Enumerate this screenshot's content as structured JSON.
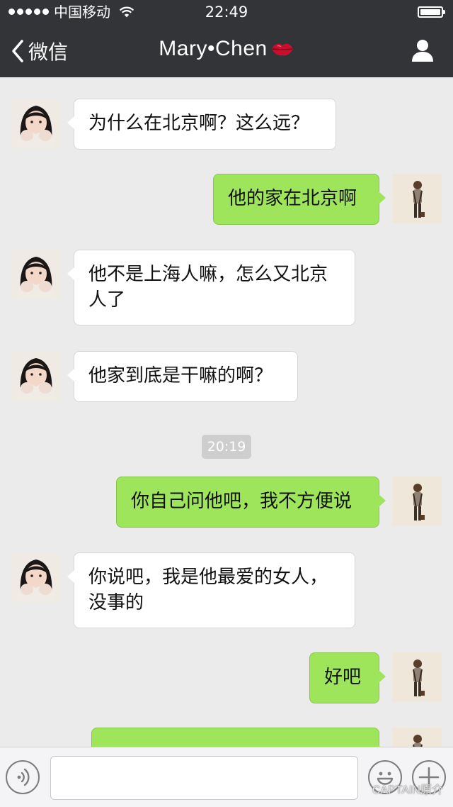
{
  "status_bar": {
    "carrier": "中国移动",
    "time": "22:49",
    "battery_level": 1.0
  },
  "nav": {
    "back_label": "微信",
    "title": "Mary•Chen",
    "title_emoji": "lips-icon",
    "right_icon": "person-icon"
  },
  "messages": [
    {
      "side": "in",
      "text": "为什么在北京啊？这么远？"
    },
    {
      "side": "out",
      "text": "他的家在北京啊"
    },
    {
      "side": "in",
      "lines": [
        "他不是上海人嘛，怎么又北京",
        "人了"
      ]
    },
    {
      "side": "in",
      "text": "他家到底是干嘛的啊？"
    },
    {
      "side": "out",
      "text": "你自己问他吧，我不方便说"
    },
    {
      "side": "in",
      "lines": [
        "你说吧，我是他最爱的女人，",
        "没事的"
      ]
    },
    {
      "side": "out",
      "text": "好吧"
    }
  ],
  "timestamp": "20:19",
  "input_bar": {
    "left_icon": "voice-icon",
    "emoji_icon": "emoji-icon",
    "plus_icon": "plus-icon"
  },
  "watermark": "CAPTAIN原介",
  "colors": {
    "header_bg": "#333437",
    "chat_bg": "#ebebeb",
    "outgoing_bubble": "#9fe55c",
    "incoming_bubble": "#ffffff"
  }
}
